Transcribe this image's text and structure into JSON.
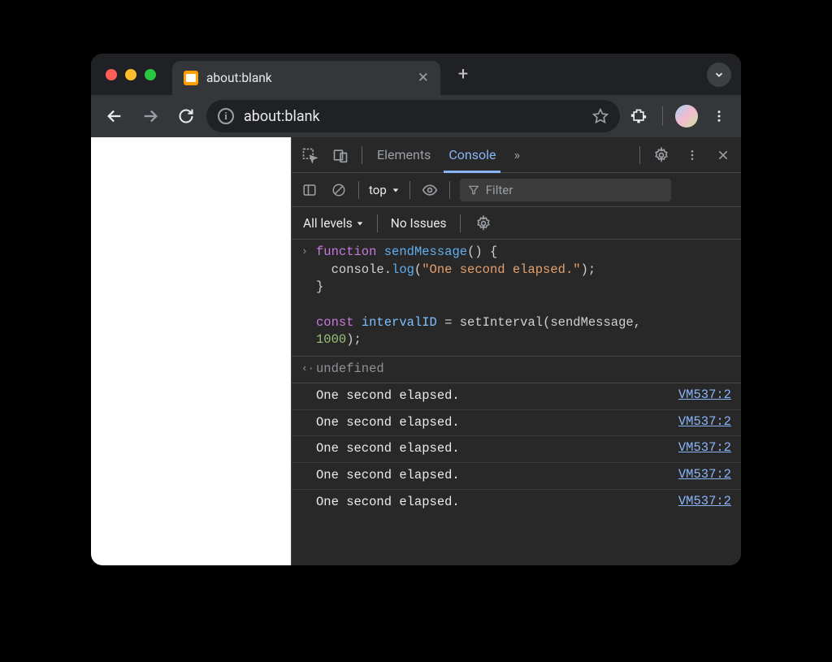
{
  "tab": {
    "title": "about:blank"
  },
  "omnibox": {
    "url": "about:blank"
  },
  "devtools": {
    "tabs": {
      "elements": "Elements",
      "console": "Console",
      "more": "»"
    },
    "subbar": {
      "context": "top",
      "filter_placeholder": "Filter"
    },
    "subbar2": {
      "levels": "All levels",
      "issues": "No Issues"
    },
    "input_code": {
      "l1a": "function",
      "l1b": " ",
      "l1c": "sendMessage",
      "l1d": "() {",
      "l2a": "  console.",
      "l2b": "log",
      "l2c": "(",
      "l2d": "\"One second elapsed.\"",
      "l2e": ");",
      "l3": "}",
      "blank": "",
      "l5a": "const",
      "l5b": " ",
      "l5c": "intervalID",
      "l5d": " = setInterval(sendMessage, ",
      "l6a": "1000",
      "l6b": ");"
    },
    "result": "undefined",
    "logs": [
      {
        "msg": "One second elapsed.",
        "src": "VM537:2"
      },
      {
        "msg": "One second elapsed.",
        "src": "VM537:2"
      },
      {
        "msg": "One second elapsed.",
        "src": "VM537:2"
      },
      {
        "msg": "One second elapsed.",
        "src": "VM537:2"
      },
      {
        "msg": "One second elapsed.",
        "src": "VM537:2"
      }
    ]
  }
}
